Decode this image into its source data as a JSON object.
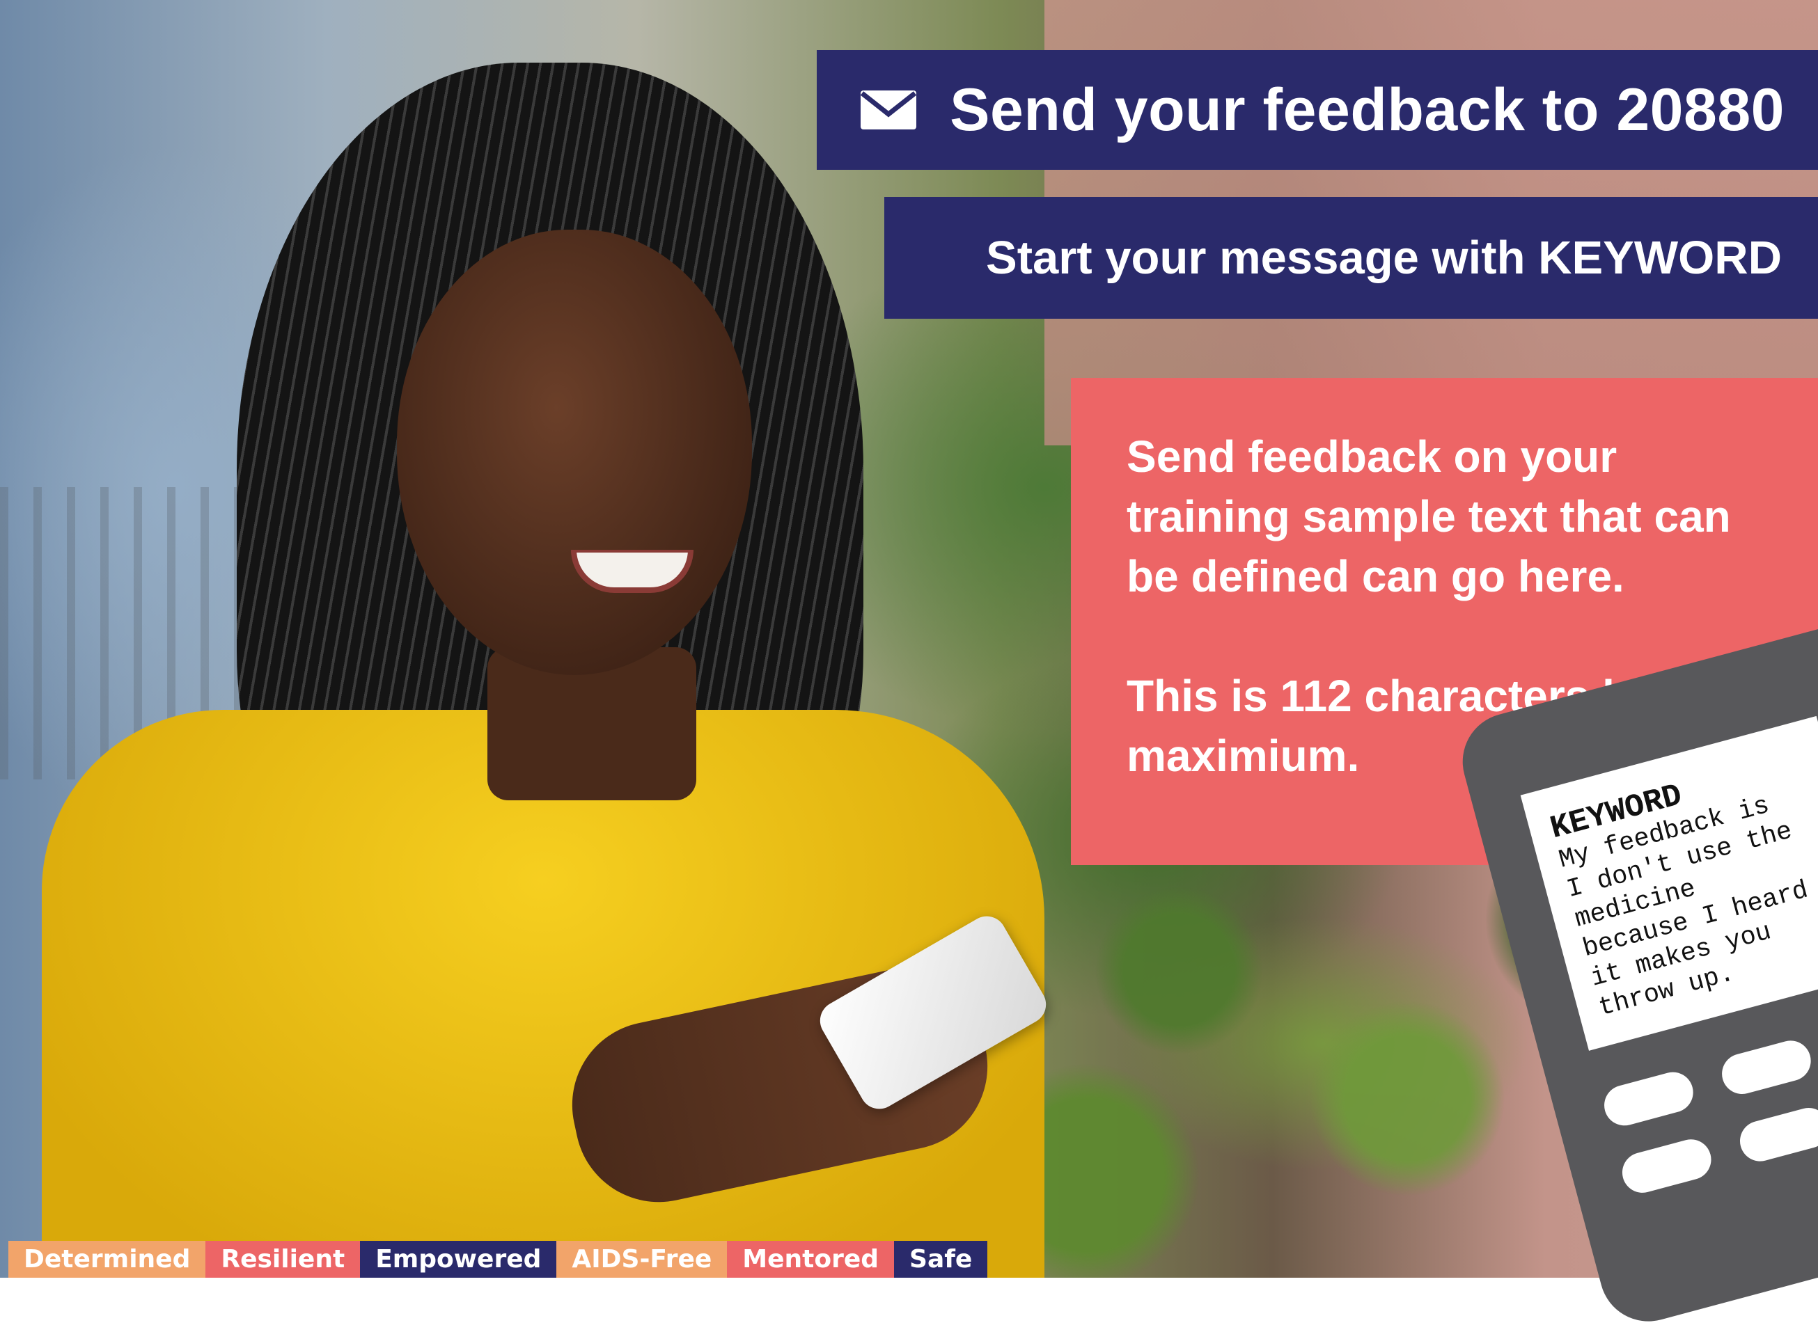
{
  "header": {
    "icon": "envelope-icon",
    "primary": "Send your feedback to 20880",
    "secondary": "Start your message with KEYWORD"
  },
  "info_box": {
    "color": "#ed6566",
    "lines": [
      "Send feedback on your training sample text that can be defined can go here.",
      "This is 112 characters long maximium."
    ]
  },
  "phone": {
    "keyword": "KEYWORD",
    "message": "My feedback is\nI don't use the\nmedicine\nbecause I heard\nit makes you\nthrow up."
  },
  "tags": [
    {
      "label": "Determined",
      "color": "#f2a46a"
    },
    {
      "label": "Resilient",
      "color": "#ed6566"
    },
    {
      "label": "Empowered",
      "color": "#2a2a6b"
    },
    {
      "label": "AIDS-Free",
      "color": "#f2a46a"
    },
    {
      "label": "Mentored",
      "color": "#ed6566"
    },
    {
      "label": "Safe",
      "color": "#2a2a6b"
    }
  ],
  "colors": {
    "navy": "#2a2a6b",
    "coral": "#ed6566",
    "orange": "#f2a46a"
  }
}
